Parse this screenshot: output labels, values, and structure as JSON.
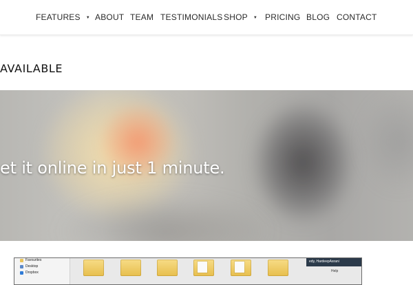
{
  "nav": {
    "items": [
      {
        "label": "FEATURES",
        "has_dropdown": true
      },
      {
        "label": "ABOUT",
        "has_dropdown": false
      },
      {
        "label": "TEAM",
        "has_dropdown": false
      },
      {
        "label": "TESTIMONIALS",
        "has_dropdown": false
      },
      {
        "label": "SHOP",
        "has_dropdown": true
      },
      {
        "label": "PRICING",
        "has_dropdown": false
      },
      {
        "label": "BLOG",
        "has_dropdown": false
      },
      {
        "label": "CONTACT",
        "has_dropdown": false
      }
    ],
    "caret_icon": "chevron-down-icon"
  },
  "section": {
    "heading": "AVAILABLE"
  },
  "hero": {
    "tagline": "et it online in just 1 minute."
  },
  "preview": {
    "sidebar": {
      "items": [
        "Favourites",
        "Desktop",
        "Dropbox"
      ]
    },
    "user_text": "edy, HardeepAsrani",
    "help_text": "Help"
  },
  "colors": {
    "nav_text": "#2a2a2a",
    "hero_text": "#ffffff",
    "folder": "#e7be4d",
    "titlebar": "#2b3a4a"
  }
}
